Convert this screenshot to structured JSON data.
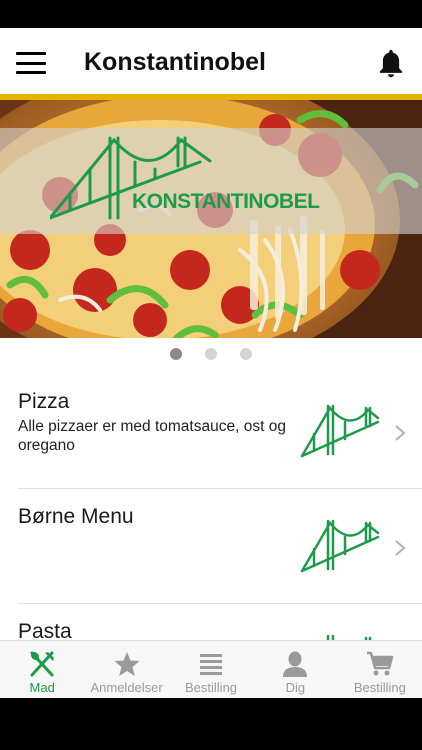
{
  "header": {
    "title": "Konstantinobel",
    "menu_icon": "hamburger-menu-icon",
    "bell_icon": "notification-bell-icon"
  },
  "banner": {
    "logo_text": "KONSTANTINOBEL",
    "slide_count": 3,
    "active_slide": 1
  },
  "colors": {
    "accent": "#e6b400",
    "brand_green": "#1e9b4a",
    "inactive": "#9a9a9a"
  },
  "menu": {
    "items": [
      {
        "title": "Pizza",
        "description": "Alle pizzaer er med tomatsauce, ost og oregano"
      },
      {
        "title": "Børne Menu",
        "description": ""
      },
      {
        "title": "Pasta",
        "description": ""
      }
    ]
  },
  "bottom_nav": {
    "tabs": [
      {
        "label": "Mad",
        "icon": "fork-knife-icon",
        "active": true
      },
      {
        "label": "Anmeldelser",
        "icon": "star-icon",
        "active": false
      },
      {
        "label": "Bestilling",
        "icon": "list-icon",
        "active": false
      },
      {
        "label": "Dig",
        "icon": "user-icon",
        "active": false
      },
      {
        "label": "Bestilling",
        "icon": "cart-icon",
        "active": false
      }
    ]
  }
}
